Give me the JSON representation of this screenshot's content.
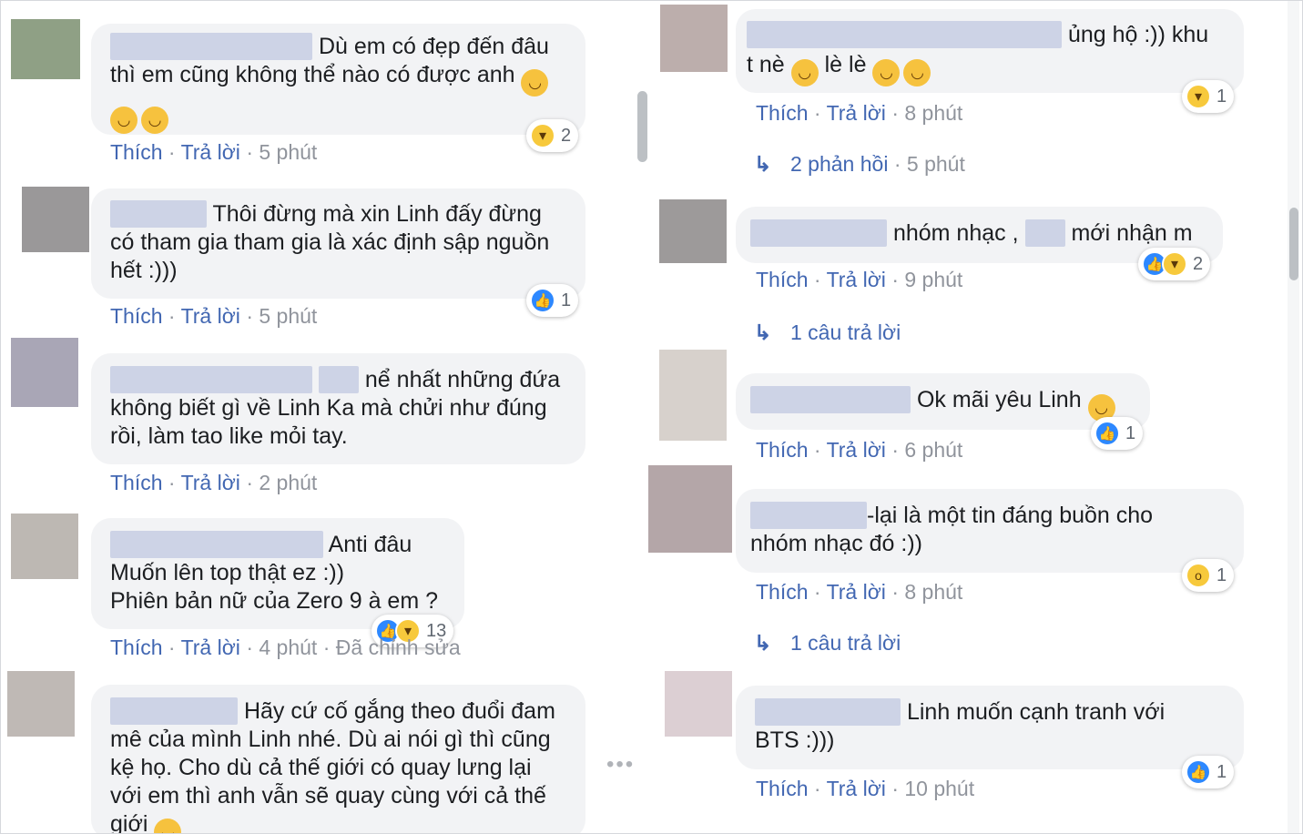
{
  "labels": {
    "like": "Thích",
    "reply": "Trả lời",
    "dot": "·"
  },
  "colors": {
    "link": "#4267b2",
    "muted": "#90949c",
    "bubble": "#f2f3f5",
    "like_blue": "#2d88ff",
    "emoji_yellow": "#f6c23e"
  },
  "left_comments": [
    {
      "lines": [
        "Dù em có đẹp đến đâu",
        "thì em cũng không thể nào có được anh"
      ],
      "time": "5 phút",
      "reaction_icons": [
        "haha-icon"
      ],
      "reaction_count": "2"
    },
    {
      "lines": [
        "Thôi đừng mà xin Linh đấy đừng",
        "có tham gia tham gia là xác định sập nguồn",
        "hết :)))"
      ],
      "time": "5 phút",
      "reaction_icons": [
        "like-icon"
      ],
      "reaction_count": "1"
    },
    {
      "lines": [
        "nể nhất những đứa",
        "không biết gì về Linh Ka mà chửi như đúng",
        "rồi, làm tao like mỏi tay."
      ],
      "time": "2 phút"
    },
    {
      "lines": [
        "Anti đâu",
        "Muốn lên top thật ez :))",
        "Phiên bản nữ của Zero 9 à em ?"
      ],
      "time": "4 phút",
      "edited": "Đã chỉnh sửa",
      "reaction_icons": [
        "like-icon",
        "haha-icon"
      ],
      "reaction_count": "13"
    },
    {
      "lines": [
        "Hãy cứ cố gắng theo đuổi đam",
        "mê của mình Linh nhé. Dù ai nói gì thì cũng",
        "kệ họ. Cho dù cả thế giới có quay lưng lại",
        "với em thì anh vẫn sẽ quay cùng với cả thế",
        "giới"
      ]
    }
  ],
  "right_comments": [
    {
      "lines": [
        "ủng hộ :)) khu",
        "t nè",
        "lè lè"
      ],
      "time": "8 phút",
      "reaction_icons": [
        "haha-icon"
      ],
      "reaction_count": "1",
      "replies_label": "2 phản hồi",
      "replies_time": "5 phút"
    },
    {
      "lines": [
        "nhóm nhạc ,",
        "mới nhận m"
      ],
      "time": "9 phút",
      "reaction_icons": [
        "like-icon",
        "haha-icon"
      ],
      "reaction_count": "2",
      "replies_label": "1 câu trả lời"
    },
    {
      "lines": [
        "Ok mãi yêu Linh"
      ],
      "time": "6 phút",
      "reaction_icons": [
        "like-icon"
      ],
      "reaction_count": "1"
    },
    {
      "lines": [
        "-lại là một tin đáng buồn cho",
        "nhóm nhạc đó :))"
      ],
      "time": "8 phút",
      "reaction_icons": [
        "wow-icon"
      ],
      "reaction_count": "1",
      "replies_label": "1 câu trả lời"
    },
    {
      "lines": [
        "Linh muốn cạnh tranh với",
        "BTS :)))"
      ],
      "time": "10 phút",
      "reaction_icons": [
        "like-icon"
      ],
      "reaction_count": "1"
    }
  ]
}
